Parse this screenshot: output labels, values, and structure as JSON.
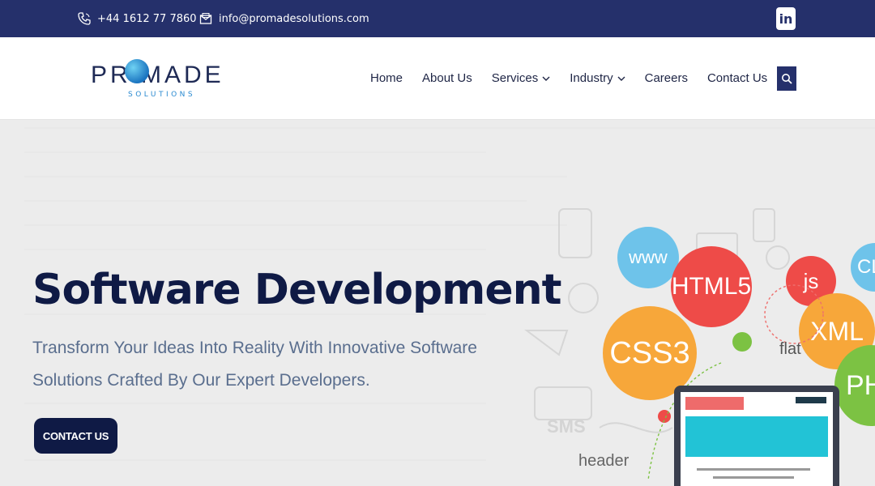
{
  "topbar": {
    "phone": "+44 1612 77 7860",
    "email": "info@promadesolutions.com",
    "linkedin_icon": "linkedin-icon",
    "linkedin_label": "in"
  },
  "logo": {
    "word": "PR   MADE",
    "sub": "SOLUTIONS"
  },
  "nav": {
    "items": [
      {
        "label": "Home",
        "dropdown": false
      },
      {
        "label": "About Us",
        "dropdown": false
      },
      {
        "label": "Services",
        "dropdown": true
      },
      {
        "label": "Industry",
        "dropdown": true
      },
      {
        "label": "Careers",
        "dropdown": false
      },
      {
        "label": "Contact Us",
        "dropdown": false
      }
    ],
    "search_icon": "search-icon"
  },
  "hero": {
    "title": "Software Development",
    "subtitle": "Transform Your Ideas Into Reality With Innovative Software Solutions Crafted By Our Expert Developers.",
    "cta_label": "CONTACT US",
    "illustration": {
      "bubbles": [
        "www",
        "HTML5",
        "CSS3",
        "js",
        "XML",
        "CL",
        "PH"
      ],
      "labels": [
        "flat",
        "header"
      ]
    }
  },
  "colors": {
    "topbar_bg": "#25306b",
    "title": "#0f1a45",
    "subtitle": "#5a6e8e",
    "cta_bg": "#0f1a45",
    "hero_bg": "#ececec"
  }
}
